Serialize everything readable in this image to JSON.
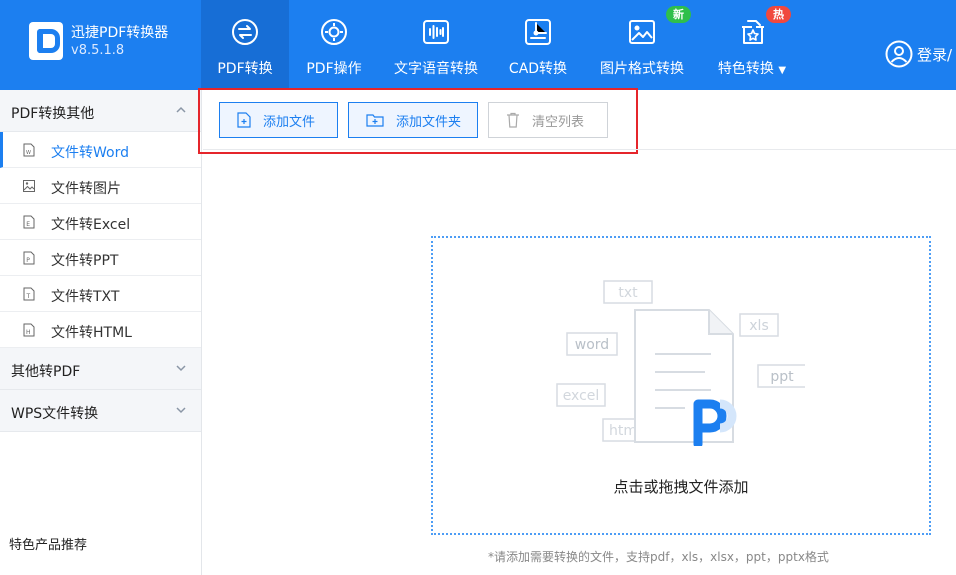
{
  "app": {
    "name": "迅捷PDF转换器",
    "version": "v8.5.1.8"
  },
  "nav": {
    "items": [
      {
        "label": "PDF转换"
      },
      {
        "label": "PDF操作"
      },
      {
        "label": "文字语音转换"
      },
      {
        "label": "CAD转换"
      },
      {
        "label": "图片格式转换",
        "badge": "新"
      },
      {
        "label": "特色转换",
        "badge": "热"
      }
    ],
    "login": "登录/"
  },
  "sidebar": {
    "groups": [
      {
        "label": "PDF转换其他",
        "expanded": true,
        "items": [
          {
            "label": "文件转Word",
            "icon": "word-doc-icon"
          },
          {
            "label": "文件转图片",
            "icon": "image-doc-icon"
          },
          {
            "label": "文件转Excel",
            "icon": "excel-doc-icon"
          },
          {
            "label": "文件转PPT",
            "icon": "ppt-doc-icon"
          },
          {
            "label": "文件转TXT",
            "icon": "txt-doc-icon"
          },
          {
            "label": "文件转HTML",
            "icon": "html-doc-icon"
          }
        ]
      },
      {
        "label": "其他转PDF",
        "expanded": false
      },
      {
        "label": "WPS文件转换",
        "expanded": false
      }
    ],
    "recommend": "特色产品推荐"
  },
  "toolbar": {
    "add_file": "添加文件",
    "add_folder": "添加文件夹",
    "clear_list": "清空列表"
  },
  "dropzone": {
    "text": "点击或拖拽文件添加",
    "tags": {
      "txt": "txt",
      "word": "word",
      "xls": "xls",
      "ppt": "ppt",
      "excel": "excel",
      "html": "html"
    }
  },
  "hint": "*请添加需要转换的文件，支持pdf，xls，xlsx，ppt，pptx格式",
  "colors": {
    "primary": "#1c7ff0",
    "highlight": "#e5252b",
    "badge_new": "#2fbf4b",
    "badge_hot": "#f0483e"
  }
}
